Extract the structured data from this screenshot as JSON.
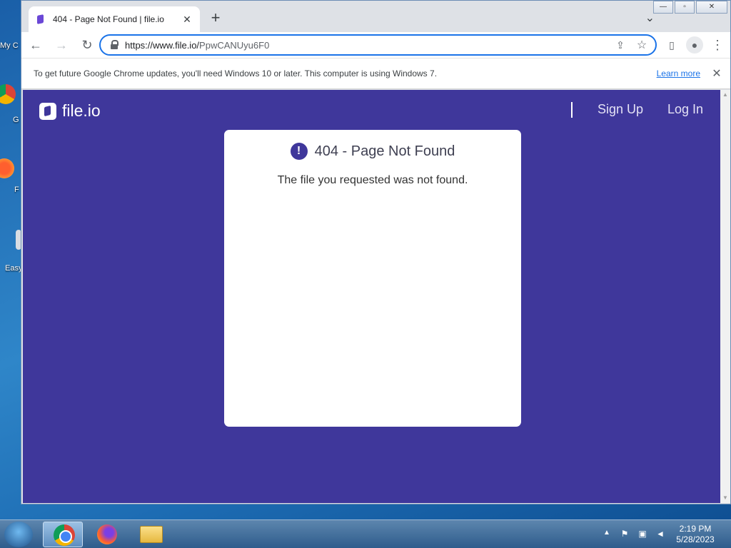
{
  "desktop": {
    "icons": [
      {
        "label": "My C",
        "icon": "computer-icon"
      },
      {
        "label": "G",
        "icon": "chrome-shortcut-icon"
      },
      {
        "label": "F",
        "icon": "firefox-shortcut-icon"
      },
      {
        "label": "Easy",
        "icon": "app-shortcut-icon"
      }
    ]
  },
  "browser": {
    "tab": {
      "title": "404 - Page Not Found | file.io",
      "close": "✕"
    },
    "new_tab": "+",
    "tab_search": "⌄",
    "window_controls": {
      "minimize": "—",
      "maximize": "▫",
      "close": "✕"
    },
    "nav": {
      "back": "←",
      "forward": "→",
      "reload": "↻"
    },
    "address": {
      "host": "https://www.file.io/",
      "path": "PpwCANUyu6F0"
    },
    "omnibox_icons": {
      "share": "⇪",
      "bookmark": "☆"
    },
    "toolbar_icons": {
      "side_panel": "▯",
      "profile": "●",
      "menu": "⋮"
    },
    "infobar": {
      "text": "To get future Google Chrome updates, you'll need Windows 10 or later. This computer is using Windows 7.",
      "link": "Learn more",
      "close": "✕"
    }
  },
  "page": {
    "logo_text": "file.io",
    "nav_links": [
      "Sign Up",
      "Log In"
    ],
    "error": {
      "icon_glyph": "!",
      "title": "404 - Page Not Found",
      "message": "The file you requested was not found."
    },
    "colors": {
      "background": "#3f379b",
      "card": "#ffffff"
    }
  },
  "taskbar": {
    "apps": [
      "chrome-icon",
      "firefox-icon",
      "file-explorer-icon"
    ],
    "tray_arrow": "▲",
    "clock": {
      "time": "2:19 PM",
      "date": "5/28/2023"
    }
  }
}
